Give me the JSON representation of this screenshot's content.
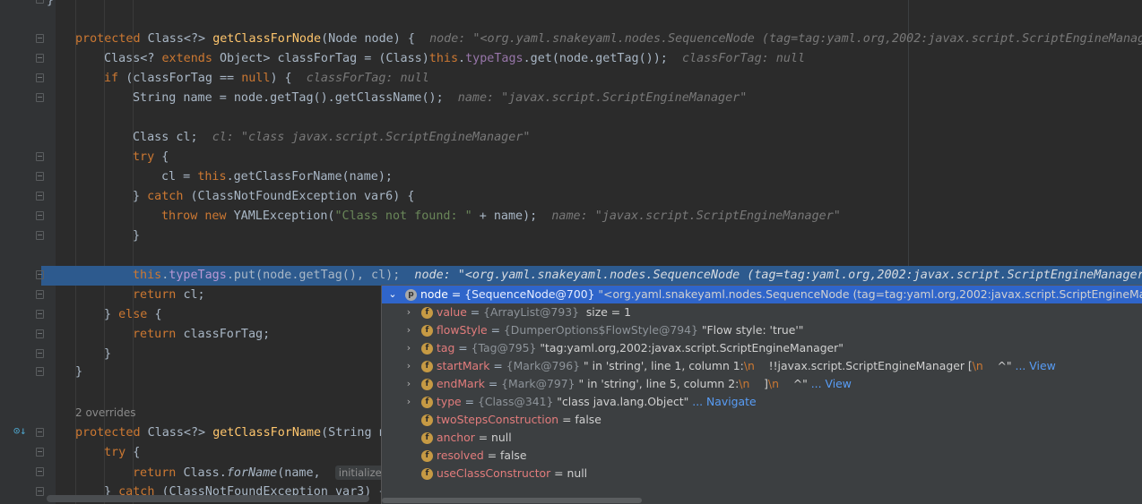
{
  "editor": {
    "lines": [
      {
        "id": "l0",
        "parts": [
          {
            "t": "}",
            "c": ""
          }
        ]
      },
      {
        "id": "l1",
        "parts": [
          {
            "t": "protected ",
            "c": "kw"
          },
          {
            "t": "Class<?> ",
            "c": ""
          },
          {
            "t": "getClassForNode",
            "c": "fn"
          },
          {
            "t": "(Node node) {  ",
            "c": ""
          },
          {
            "t": "node: \"<org.yaml.snakeyaml.nodes.SequenceNode (tag=tag:yaml.org,2002:javax.script.ScriptEngineManag",
            "c": "hint"
          }
        ]
      },
      {
        "id": "l2",
        "parts": [
          {
            "t": "Class<? ",
            "c": ""
          },
          {
            "t": "extends ",
            "c": "kw"
          },
          {
            "t": "Object> classForTag = (Class)",
            "c": ""
          },
          {
            "t": "this",
            "c": "kw"
          },
          {
            "t": ".",
            "c": ""
          },
          {
            "t": "typeTags",
            "c": "fld"
          },
          {
            "t": ".get(node.getTag());  ",
            "c": ""
          },
          {
            "t": "classForTag: null",
            "c": "hint"
          }
        ]
      },
      {
        "id": "l3",
        "parts": [
          {
            "t": "if ",
            "c": "kw"
          },
          {
            "t": "(classForTag == ",
            "c": ""
          },
          {
            "t": "null",
            "c": "kw"
          },
          {
            "t": ") {  ",
            "c": ""
          },
          {
            "t": "classForTag: null",
            "c": "hint"
          }
        ]
      },
      {
        "id": "l4",
        "parts": [
          {
            "t": "String name = node.getTag().getClassName();  ",
            "c": ""
          },
          {
            "t": "name: \"javax.script.ScriptEngineManager\"",
            "c": "hint"
          }
        ]
      },
      {
        "id": "l5",
        "parts": []
      },
      {
        "id": "l6",
        "parts": [
          {
            "t": "Class cl;  ",
            "c": ""
          },
          {
            "t": "cl: \"class javax.script.ScriptEngineManager\"",
            "c": "hint"
          }
        ]
      },
      {
        "id": "l7",
        "parts": [
          {
            "t": "try ",
            "c": "kw"
          },
          {
            "t": "{",
            "c": ""
          }
        ]
      },
      {
        "id": "l8",
        "parts": [
          {
            "t": "cl = ",
            "c": ""
          },
          {
            "t": "this",
            "c": "kw"
          },
          {
            "t": ".getClassForName(name);",
            "c": ""
          }
        ]
      },
      {
        "id": "l9",
        "parts": [
          {
            "t": "} ",
            "c": ""
          },
          {
            "t": "catch ",
            "c": "kw"
          },
          {
            "t": "(ClassNotFoundException var6) {",
            "c": ""
          }
        ]
      },
      {
        "id": "l10",
        "parts": [
          {
            "t": "throw new ",
            "c": "kw"
          },
          {
            "t": "YAMLException(",
            "c": ""
          },
          {
            "t": "\"Class not found: \"",
            "c": "str"
          },
          {
            "t": " + name);  ",
            "c": ""
          },
          {
            "t": "name: \"javax.script.ScriptEngineManager\"",
            "c": "hint"
          }
        ]
      },
      {
        "id": "l11",
        "parts": [
          {
            "t": "}",
            "c": ""
          }
        ]
      },
      {
        "id": "l12",
        "parts": []
      },
      {
        "id": "l13",
        "parts": [
          {
            "t": "this",
            "c": "kw"
          },
          {
            "t": ".",
            "c": ""
          },
          {
            "t": "typeTags",
            "c": "fld"
          },
          {
            "t": ".put(node.getTag(), cl);  ",
            "c": ""
          },
          {
            "t": "node: \"<org.yaml.snakeyaml.nodes.SequenceNode (tag=tag:yaml.org,2002:javax.script.ScriptEngineManager",
            "c": "hint"
          }
        ]
      },
      {
        "id": "l14",
        "parts": [
          {
            "t": "return ",
            "c": "kw"
          },
          {
            "t": "cl;",
            "c": ""
          }
        ]
      },
      {
        "id": "l15",
        "parts": [
          {
            "t": "} ",
            "c": ""
          },
          {
            "t": "else ",
            "c": "kw"
          },
          {
            "t": "{",
            "c": ""
          }
        ]
      },
      {
        "id": "l16",
        "parts": [
          {
            "t": "return ",
            "c": "kw"
          },
          {
            "t": "classForTag;",
            "c": ""
          }
        ]
      },
      {
        "id": "l17",
        "parts": [
          {
            "t": "}",
            "c": ""
          }
        ]
      },
      {
        "id": "l18",
        "parts": [
          {
            "t": "}",
            "c": ""
          }
        ]
      },
      {
        "id": "l19",
        "parts": []
      },
      {
        "id": "l20",
        "parts": []
      },
      {
        "id": "l21",
        "parts": [
          {
            "t": "protected ",
            "c": "kw"
          },
          {
            "t": "Class<?> ",
            "c": ""
          },
          {
            "t": "getClassForName",
            "c": "fn"
          },
          {
            "t": "(String n",
            "c": ""
          }
        ]
      },
      {
        "id": "l22",
        "parts": [
          {
            "t": "try ",
            "c": "kw"
          },
          {
            "t": "{",
            "c": ""
          }
        ]
      },
      {
        "id": "l23",
        "parts": [
          {
            "t": "return ",
            "c": "kw"
          },
          {
            "t": "Class.",
            "c": ""
          },
          {
            "t": "forName",
            "c": "ital"
          },
          {
            "t": "(name,  ",
            "c": ""
          },
          {
            "t": "initialize:",
            "c": "inlay"
          }
        ]
      },
      {
        "id": "l24",
        "parts": [
          {
            "t": "} ",
            "c": ""
          },
          {
            "t": "catch ",
            "c": "kw"
          },
          {
            "t": "(ClassNotFoundException var3) {",
            "c": ""
          }
        ]
      }
    ],
    "overrides_label": "2 overrides"
  },
  "debug_popup": {
    "rows": [
      {
        "badge": "p",
        "name": "node",
        "type": "{SequenceNode@700}",
        "value": " \"<org.yaml.snakeyaml.nodes.SequenceNode (tag=tag:yaml.org,2002:javax.script.ScriptEngineManager, valu",
        "expand": "v",
        "selected": true
      },
      {
        "badge": "f",
        "name": "value",
        "type": "{ArrayList@793}",
        "value": "  size = 1",
        "expand": ">"
      },
      {
        "badge": "f",
        "name": "flowStyle",
        "type": "{DumperOptions$FlowStyle@794}",
        "value": " \"Flow style: 'true'\"",
        "expand": ">"
      },
      {
        "badge": "f",
        "name": "tag",
        "type": "{Tag@795}",
        "value": " \"tag:yaml.org,2002:javax.script.ScriptEngineManager\"",
        "expand": ">"
      },
      {
        "badge": "f",
        "name": "startMark",
        "type": "{Mark@796}",
        "value": " \" in 'string', line 1, column 1:",
        "esc": "\\n",
        "value2": "    !!javax.script.ScriptEngineManager [",
        "esc2": "\\n",
        "value3": "    ^\"",
        "link": " ... View",
        "expand": ">"
      },
      {
        "badge": "f",
        "name": "endMark",
        "type": "{Mark@797}",
        "value": " \" in 'string', line 5, column 2:",
        "esc": "\\n",
        "value2": "    ]",
        "esc2": "\\n",
        "value3": "    ^\"",
        "link": " ... View",
        "expand": ">"
      },
      {
        "badge": "f",
        "name": "type",
        "type": "{Class@341}",
        "value": " \"class java.lang.Object\"",
        "link": " ... Navigate",
        "expand": ">"
      },
      {
        "badge": "f",
        "name": "twoStepsConstruction",
        "type": "",
        "value": " = false",
        "expand": ""
      },
      {
        "badge": "f",
        "name": "anchor",
        "type": "",
        "value": " = null",
        "expand": ""
      },
      {
        "badge": "f",
        "name": "resolved",
        "type": "",
        "value": " = false",
        "expand": ""
      },
      {
        "badge": "f",
        "name": "useClassConstructor",
        "type": "",
        "value": " = null",
        "expand": ""
      }
    ]
  }
}
